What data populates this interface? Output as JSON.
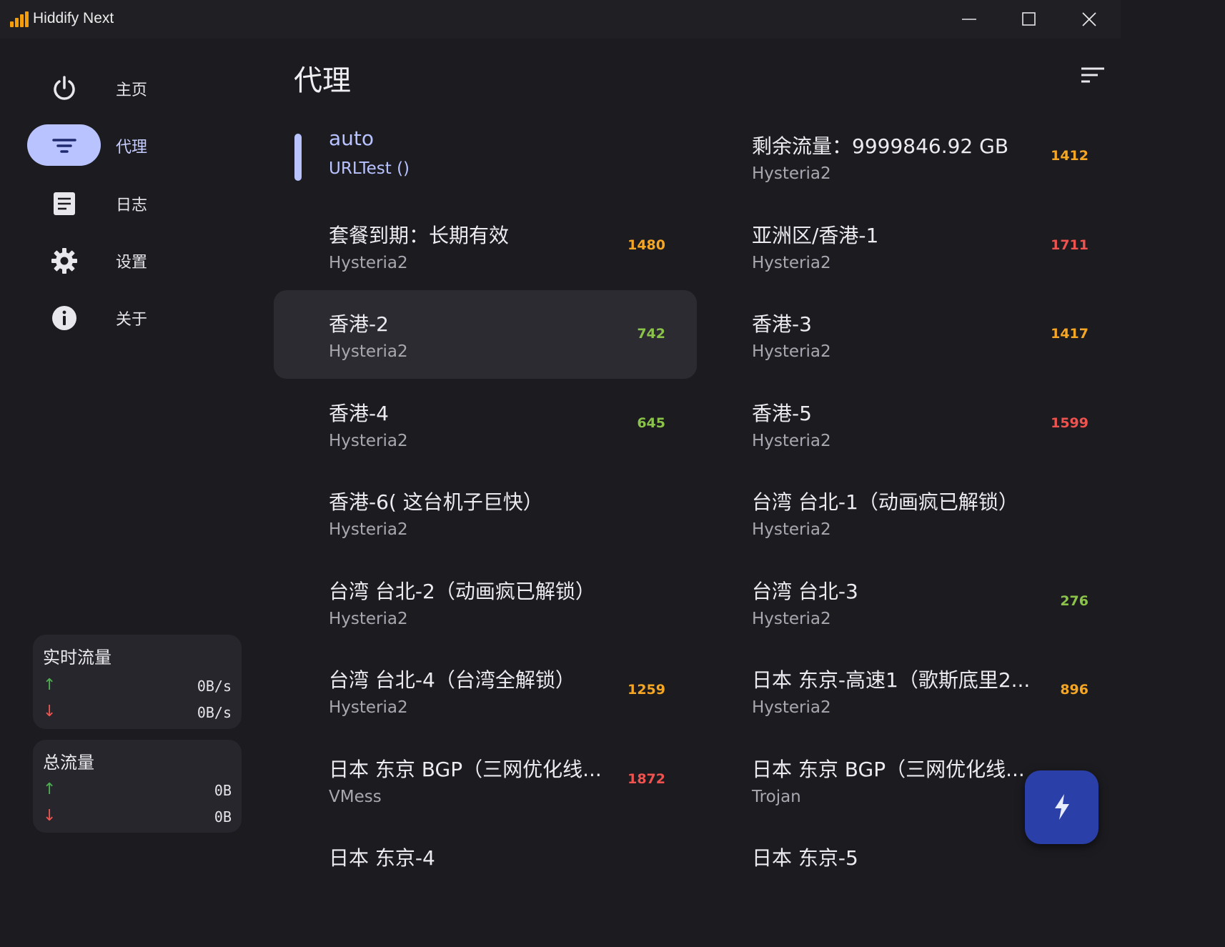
{
  "window": {
    "title": "Hiddify Next"
  },
  "sidebar": {
    "items": [
      {
        "label": "主页",
        "icon": "power-icon"
      },
      {
        "label": "代理",
        "icon": "filter-icon",
        "active": true
      },
      {
        "label": "日志",
        "icon": "document-icon"
      },
      {
        "label": "设置",
        "icon": "gear-icon"
      },
      {
        "label": "关于",
        "icon": "info-icon"
      }
    ]
  },
  "stats": {
    "realtime": {
      "title": "实时流量",
      "up": "0B/s",
      "down": "0B/s"
    },
    "total": {
      "title": "总流量",
      "up": "0B",
      "down": "0B"
    }
  },
  "page": {
    "title": "代理"
  },
  "proxies": [
    {
      "name": "auto",
      "type": "URLTest ()",
      "delay": "",
      "status": "",
      "active": true
    },
    {
      "name": "剩余流量：9999846.92 GB",
      "type": "Hysteria2",
      "delay": "1412",
      "status": "orange"
    },
    {
      "name": "套餐到期：长期有效",
      "type": "Hysteria2",
      "delay": "1480",
      "status": "orange"
    },
    {
      "name": "亚洲区/香港-1",
      "type": "Hysteria2",
      "delay": "1711",
      "status": "red"
    },
    {
      "name": "香港-2",
      "type": "Hysteria2",
      "delay": "742",
      "status": "green",
      "selected": true
    },
    {
      "name": "香港-3",
      "type": "Hysteria2",
      "delay": "1417",
      "status": "orange"
    },
    {
      "name": "香港-4",
      "type": "Hysteria2",
      "delay": "645",
      "status": "green"
    },
    {
      "name": "香港-5",
      "type": "Hysteria2",
      "delay": "1599",
      "status": "red"
    },
    {
      "name": "香港-6( 这台机子巨快）",
      "type": "Hysteria2",
      "delay": "",
      "status": ""
    },
    {
      "name": "台湾 台北-1（动画疯已解锁）",
      "type": "Hysteria2",
      "delay": "",
      "status": ""
    },
    {
      "name": "台湾 台北-2（动画疯已解锁）",
      "type": "Hysteria2",
      "delay": "",
      "status": ""
    },
    {
      "name": "台湾 台北-3",
      "type": "Hysteria2",
      "delay": "276",
      "status": "green"
    },
    {
      "name": "台湾 台北-4（台湾全解锁）",
      "type": "Hysteria2",
      "delay": "1259",
      "status": "orange"
    },
    {
      "name": "日本 东京-高速1（歌斯底里2...",
      "type": "Hysteria2",
      "delay": "896",
      "status": "orange"
    },
    {
      "name": "日本 东京 BGP（三网优化线...",
      "type": "VMess",
      "delay": "1872",
      "status": "red"
    },
    {
      "name": "日本 东京 BGP（三网优化线...",
      "type": "Trojan",
      "delay": "",
      "status": ""
    },
    {
      "name": "日本 东京-4",
      "type": "",
      "delay": "",
      "status": ""
    },
    {
      "name": "日本 东京-5",
      "type": "",
      "delay": "",
      "status": ""
    }
  ],
  "fab": {
    "icon": "lightning-icon"
  }
}
